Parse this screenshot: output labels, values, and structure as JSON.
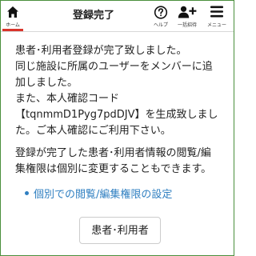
{
  "header": {
    "title": "登録完了",
    "home_label": "ホーム",
    "help_label": "ヘルプ",
    "invite_label": "一括招待",
    "menu_label": "メニュー"
  },
  "colors": {
    "accent_red": "#d9342b",
    "link_blue": "#2f7fc1",
    "border_green": "#4a8f3c"
  },
  "icons": {
    "home": "home-icon",
    "help": "help-circle-icon",
    "invite": "user-plus-icon",
    "menu": "hamburger-menu-icon"
  },
  "message": {
    "lines": [
      "患者･利用者登録が完了致しました。",
      "同じ施設に所属のユーザーをメンバーに追",
      "加しました。",
      "また、本人確認コード",
      "【tqnmmD1Pyg7pdDJV】を生成致しまし",
      "た。ご本人確認にご利用下さい。"
    ],
    "note_lines": [
      "登録が完了した患者･利用者情報の閲覧/編",
      "集権限は個別に変更することもできます。"
    ]
  },
  "link_label": "個別での閲覧/編集権限の設定",
  "patient_button_label": "患者･利用者"
}
